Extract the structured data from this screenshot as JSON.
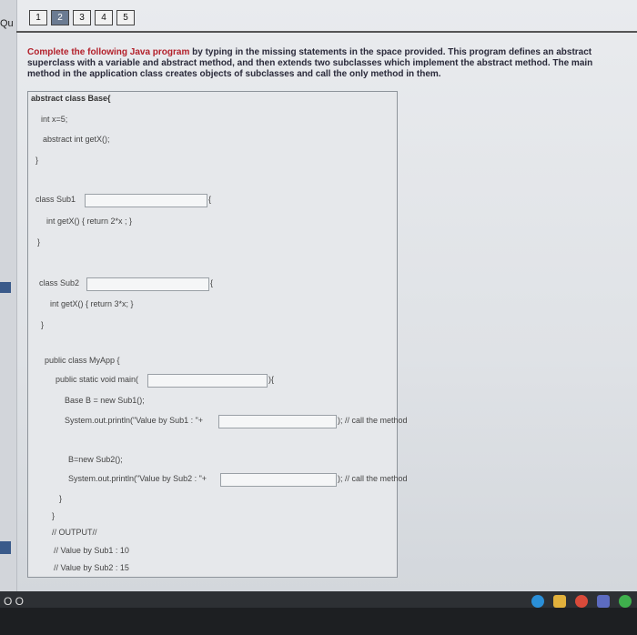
{
  "sidebar": {
    "label": "Qu"
  },
  "question_nav": {
    "items": [
      "1",
      "2",
      "3",
      "4",
      "5"
    ]
  },
  "instructions": {
    "lead": "Complete the following Java program",
    "rest": " by typing in the missing statements in the space provided. This program defines an abstract superclass with a variable and abstract method, and then extends two subclasses which implement the abstract method. The main method in the application class creates objects of subclasses and call the only method in them."
  },
  "code": {
    "base_decl": "abstract class Base{",
    "base_var": "int x=5;",
    "base_method": "abstract int getX();",
    "close1": "}",
    "sub1_decl": "class Sub1",
    "sub1_brace": "{",
    "sub1_method": "int getX() { return  2*x ; }",
    "close2": "}",
    "sub2_decl": "class Sub2",
    "sub2_brace": "{",
    "sub2_method": "int getX() { return  3*x; }",
    "close3": "}",
    "app_decl": "public class MyApp {",
    "main_decl": "public static void main(",
    "main_close": "){",
    "stmt1": "Base B = new Sub1();",
    "print1": "System.out.println(\"Value by Sub1 : \"+",
    "print1_end": ");  // call the method",
    "stmt2": "B=new Sub2();",
    "print2": "System.out.println(\"Value by Sub2 : \"+",
    "print2_end": ");  // call the method",
    "close4": "}",
    "close5": "}",
    "out_label": "// OUTPUT//",
    "out1": "// Value by Sub1 : 10",
    "out2": "// Value by Sub2 : 15"
  },
  "taskbar": {
    "left_icons": "O  O"
  }
}
